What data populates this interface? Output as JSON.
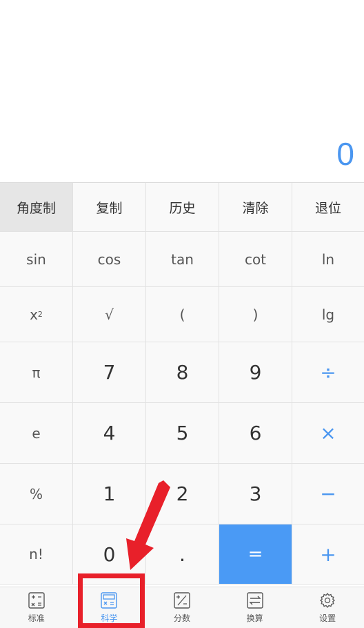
{
  "display": {
    "value": "0"
  },
  "function_row": [
    "角度制",
    "复制",
    "历史",
    "清除",
    "退位"
  ],
  "sci_row_1": [
    "sin",
    "cos",
    "tan",
    "cot",
    "ln"
  ],
  "sci_row_2": {
    "x2_base": "x",
    "x2_exp": "2",
    "sqrt": "√",
    "lparen": "(",
    "rparen": ")",
    "lg": "lg"
  },
  "rows": {
    "r789": [
      "π",
      "7",
      "8",
      "9",
      "÷"
    ],
    "r456": [
      "e",
      "4",
      "5",
      "6",
      "×"
    ],
    "r123": [
      "%",
      "1",
      "2",
      "3",
      "−"
    ],
    "r0": [
      "n!",
      "0",
      ".",
      "=",
      "+"
    ]
  },
  "tabs": [
    {
      "label": "标准",
      "icon": "standard-calc-icon"
    },
    {
      "label": "科学",
      "icon": "scientific-calc-icon",
      "selected": true
    },
    {
      "label": "分数",
      "icon": "fraction-icon"
    },
    {
      "label": "换算",
      "icon": "conversion-icon"
    },
    {
      "label": "设置",
      "icon": "gear-icon"
    }
  ],
  "colors": {
    "accent": "#4a96f0",
    "equals_bg": "#4a9af5",
    "annotation": "#e8202a"
  }
}
